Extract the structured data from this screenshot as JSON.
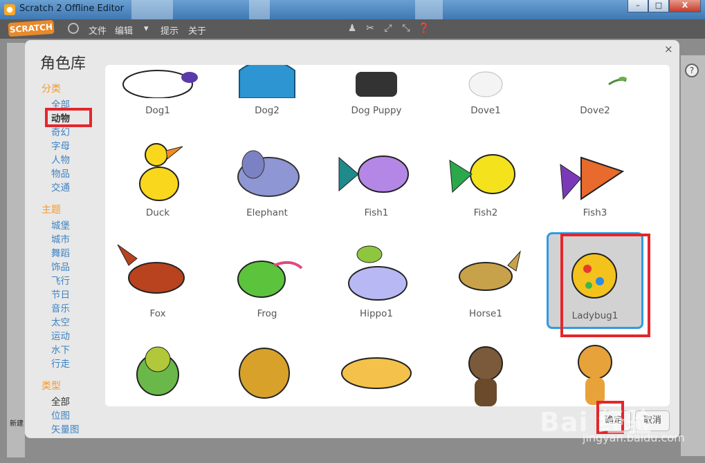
{
  "window": {
    "title": "Scratch 2 Offline Editor",
    "minimize": "–",
    "maximize": "□",
    "close": "X"
  },
  "menubar": {
    "logo": "SCRATCH",
    "file": "文件",
    "edit": "编辑",
    "tips": "提示",
    "about": "关于"
  },
  "editor": {
    "new_sprite_label": "新建",
    "help": "?"
  },
  "modal": {
    "title": "角色库",
    "close": "×",
    "category_heading": "分类",
    "categories": [
      "全部",
      "动物",
      "奇幻",
      "字母",
      "人物",
      "物品",
      "交通"
    ],
    "theme_heading": "主题",
    "themes": [
      "城堡",
      "城市",
      "舞蹈",
      "饰品",
      "飞行",
      "节日",
      "音乐",
      "太空",
      "运动",
      "水下",
      "行走"
    ],
    "type_heading": "类型",
    "types": [
      "全部",
      "位图",
      "矢量图"
    ],
    "sprites": [
      "Dog1",
      "Dog2",
      "Dog Puppy",
      "Dove1",
      "Dove2",
      "Duck",
      "Elephant",
      "Fish1",
      "Fish2",
      "Fish3",
      "Fox",
      "Frog",
      "Hippo1",
      "Horse1",
      "Ladybug1",
      "",
      "",
      "",
      "",
      ""
    ],
    "selected_sprite": "Ladybug1",
    "ok_label": "确定",
    "cancel_label": "取消"
  },
  "watermark": {
    "brand": "Bai 经验",
    "url": "jingyan.baidu.com"
  }
}
